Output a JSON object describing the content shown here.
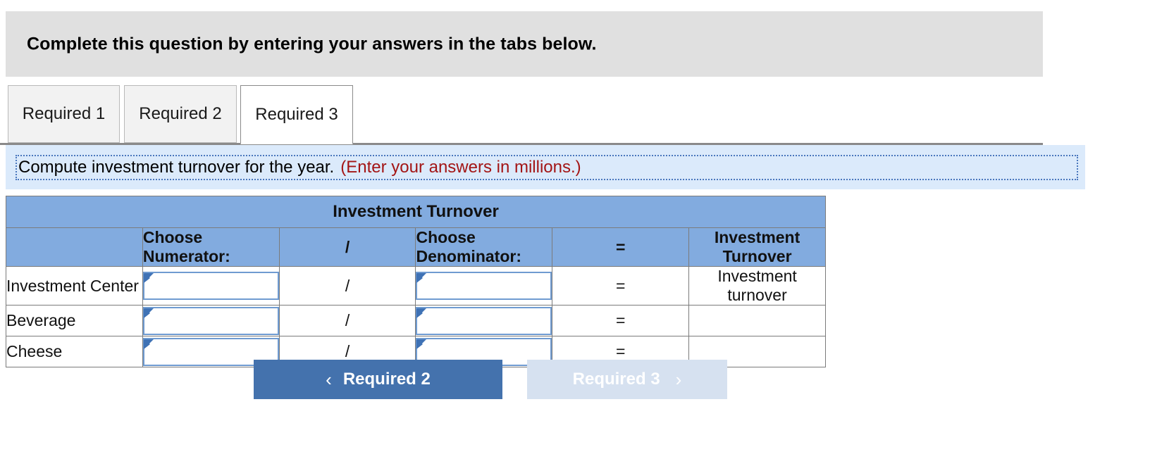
{
  "banner": {
    "text": "Complete this question by entering your answers in the tabs below."
  },
  "tabs": [
    {
      "label": "Required 1",
      "active": false
    },
    {
      "label": "Required 2",
      "active": false
    },
    {
      "label": "Required 3",
      "active": true
    }
  ],
  "instruction": {
    "main": "Compute investment turnover for the year.",
    "note": "(Enter your answers in millions.)",
    "note_color": "#a31515"
  },
  "table": {
    "title": "Investment Turnover",
    "headers": {
      "blank": "",
      "numerator": "Choose Numerator:",
      "slash": "/",
      "denominator": "Choose Denominator:",
      "equals": "=",
      "result": "Investment Turnover"
    },
    "rows": [
      {
        "label": "Investment Center",
        "numerator": "",
        "slash": "/",
        "denominator": "",
        "equals": "=",
        "result": "Investment turnover"
      },
      {
        "label": "Beverage",
        "numerator": "",
        "slash": "/",
        "denominator": "",
        "equals": "=",
        "result": ""
      },
      {
        "label": "Cheese",
        "numerator": "",
        "slash": "/",
        "denominator": "",
        "equals": "=",
        "result": ""
      }
    ]
  },
  "nav": {
    "prev": {
      "label": "Required 2",
      "icon": "chevron-left-icon",
      "glyph": "‹",
      "enabled": true
    },
    "next": {
      "label": "Required 3",
      "icon": "chevron-right-icon",
      "glyph": "›",
      "enabled": false
    }
  },
  "colors": {
    "banner_bg": "#e0e0e0",
    "instruction_bg": "#dbeafb",
    "table_header_bg": "#82abdf",
    "button_primary": "#4472ad",
    "button_disabled": "#d6e1f0",
    "input_border": "#6f9bd1",
    "marker": "#3f72b5"
  }
}
